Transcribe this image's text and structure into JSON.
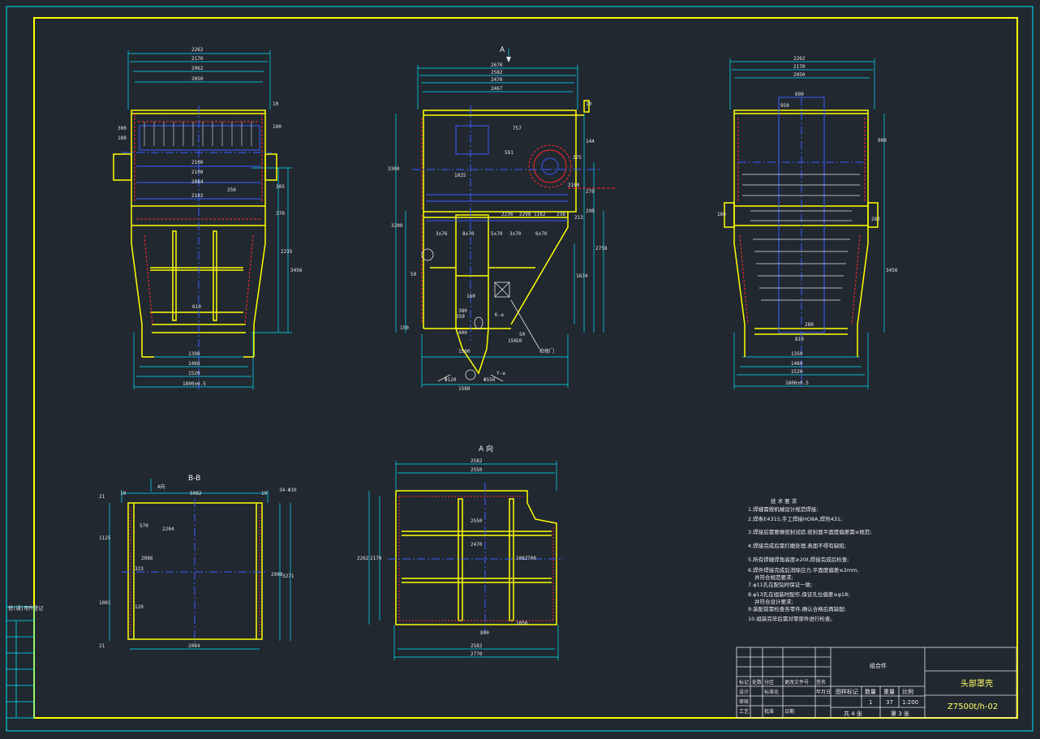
{
  "colors": {
    "background": "#212830",
    "frame": "#ffff00",
    "cyan": "#00e5ff",
    "blue": "#3a5bff",
    "red": "#ff2a2a",
    "white": "#e6e6e6"
  },
  "views": {
    "front": {
      "dims_top": [
        "2262",
        "2170",
        "2062",
        "2050"
      ],
      "dims_inner": [
        "2100",
        "2100",
        "2084",
        "2102"
      ],
      "dims_right": [
        "10",
        "100",
        "2235",
        "3456",
        "370",
        "305",
        "250"
      ],
      "dims_left": [
        "300",
        "180"
      ],
      "dims_bottom": [
        "1390",
        "1460",
        "1520",
        "1800±0.5"
      ],
      "mark_center": "610"
    },
    "side": {
      "arrow_label": "A",
      "dims_top": [
        "2670",
        "2582",
        "2470",
        "2467"
      ],
      "dims_top_right": "10",
      "dims_middle": [
        "757",
        "591",
        "1025",
        "2236",
        "2298",
        "1182"
      ],
      "dims_right": [
        "144",
        "270",
        "375",
        "290",
        "2100",
        "213",
        "238",
        "2758",
        "1634"
      ],
      "dims_bottom": [
        "1500",
        "1580",
        "150",
        "10",
        "50"
      ],
      "dims_inner": [
        "3x76",
        "8x70",
        "5x70",
        "3x70",
        "6x70",
        "3200",
        "160",
        "380",
        "350",
        "400"
      ],
      "dims_left": [
        "50",
        "150",
        "3300"
      ],
      "callouts": [
        "K-a",
        "检修门"
      ],
      "dims_motor": [
        "Φ120",
        "Φ550",
        "Y-a"
      ]
    },
    "right": {
      "dims_top": [
        "2262",
        "2170",
        "2050"
      ],
      "dims_upper": [
        "600",
        "950",
        "900"
      ],
      "dims_right": [
        "282",
        "3456"
      ],
      "dims_left": [
        "180"
      ],
      "dims_bottom": [
        "1350",
        "1460",
        "1520",
        "1800±0.5"
      ],
      "mark_center": "810",
      "mark_low": "280"
    },
    "section_bb": {
      "title": "B-B",
      "arrow_note": "A向",
      "dims_top": [
        "10",
        "5082",
        "10",
        "34-Φ10"
      ],
      "dims_left": [
        "21",
        "1125",
        "1001",
        "21"
      ],
      "dims_inner": [
        "570",
        "2204",
        "2086",
        "323",
        "120"
      ],
      "dims_right": [
        "2998",
        "3271"
      ],
      "dims_bottom": "2084"
    },
    "view_a": {
      "title": "A 向",
      "dims_top": [
        "2582",
        "2550"
      ],
      "dims_inner": [
        "2550",
        "2470",
        "1082",
        "700",
        "1050",
        "800"
      ],
      "dims_left": [
        "2262",
        "2170"
      ],
      "dims_bottom": [
        "2582",
        "2770"
      ]
    }
  },
  "notes": {
    "heading": "技 术 要 求",
    "items": [
      "1.焊缝需按机械设计规范焊接;",
      "2.焊条E4315,手工焊接HO8A,焊剂431;",
      "3.焊接后需要做密封试验,密封面平面度偏差需≤规范;",
      "4.焊接完成后需打磨处理,表面不得有缺陷;",
      "5.所有焊缝焊角高度≥20ℓ,焊接完成后检查;",
      "6.焊件焊接完成后消除应力,平面度偏差≤2mm,",
      "并符合规范要求;",
      "7.φ11孔在配钻时保证一致;",
      "8.φ13孔在组装时配作,保证孔位偏差≤φ18;",
      "并符合设计要求;",
      "9.装配前需检查各零件,确认合格后再装配;",
      "10.组装完毕后需对零部件进行检查。"
    ]
  },
  "title_block": {
    "left_tag": "组合件",
    "part_name": "头部罩壳",
    "drawing_no": "Z7500t/h-02",
    "scale": "1:200",
    "count": "1",
    "weight": "37",
    "sheet_total_label": "共 4 张",
    "sheet_label": "第 3 张",
    "headers": [
      "图样标记",
      "数量",
      "重量",
      "比例"
    ],
    "rows_left": [
      "标记",
      "处数",
      "分区",
      "更改文件号",
      "签名",
      "年月日"
    ],
    "role_labels": [
      "设计",
      "标准化",
      "审核",
      "工艺",
      "批准",
      "日期"
    ],
    "side_strip_top": "借(通)用件登记"
  }
}
